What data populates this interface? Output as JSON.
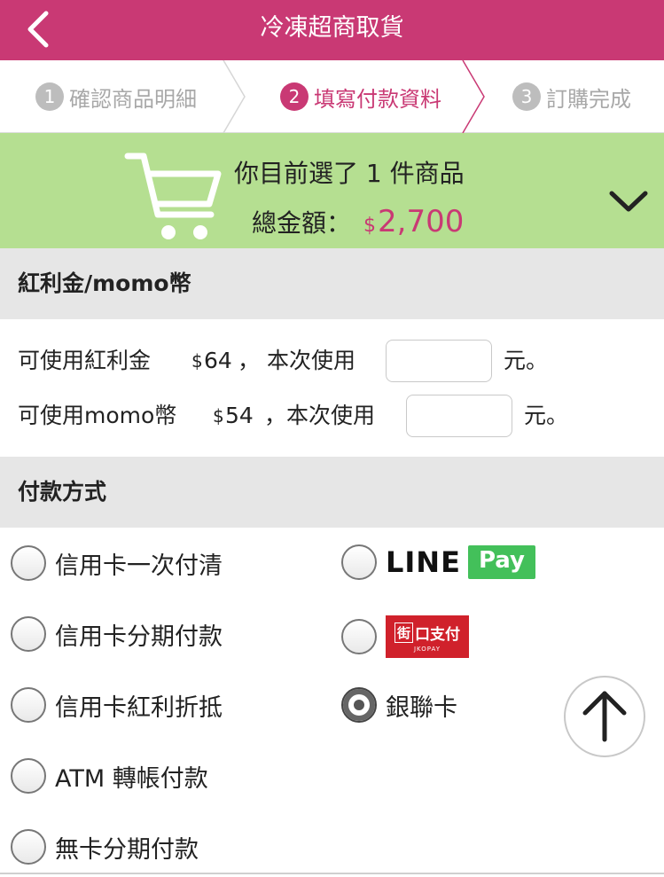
{
  "header": {
    "title": "冷凍超商取貨"
  },
  "steps": [
    {
      "num": "1",
      "label": "確認商品明細",
      "state": "done"
    },
    {
      "num": "2",
      "label": "填寫付款資料",
      "state": "active"
    },
    {
      "num": "3",
      "label": "訂購完成",
      "state": "pending"
    }
  ],
  "summary": {
    "line1": "你目前選了 1 件商品",
    "total_label": "總金額：",
    "currency": "$",
    "amount": "2,700"
  },
  "bonus": {
    "title": "紅利金/momo幣",
    "row1": {
      "prefix": "可使用紅利金",
      "currency": "$",
      "value": "64",
      "mid": "， 本次使用",
      "suffix": "元。",
      "input_value": ""
    },
    "row2": {
      "prefix": "可使用momo幣",
      "currency": "$",
      "value": "54",
      "mid": "，本次使用",
      "suffix": "元。",
      "input_value": ""
    }
  },
  "payment": {
    "title": "付款方式",
    "options_left": [
      "信用卡一次付清",
      "信用卡分期付款",
      "信用卡紅利折抵",
      "ATM 轉帳付款",
      "無卡分期付款"
    ],
    "line_pay": {
      "word": "LINE",
      "pay": "Pay"
    },
    "jko": {
      "char": "街",
      "text": "口支付",
      "sub": "JKOPAY"
    },
    "unionpay": "銀聯卡",
    "selected": "銀聯卡"
  },
  "colors": {
    "brand": "#c93974",
    "summary_bg": "#b5df91",
    "line_green": "#43c05a",
    "jko_red": "#d0212b"
  }
}
